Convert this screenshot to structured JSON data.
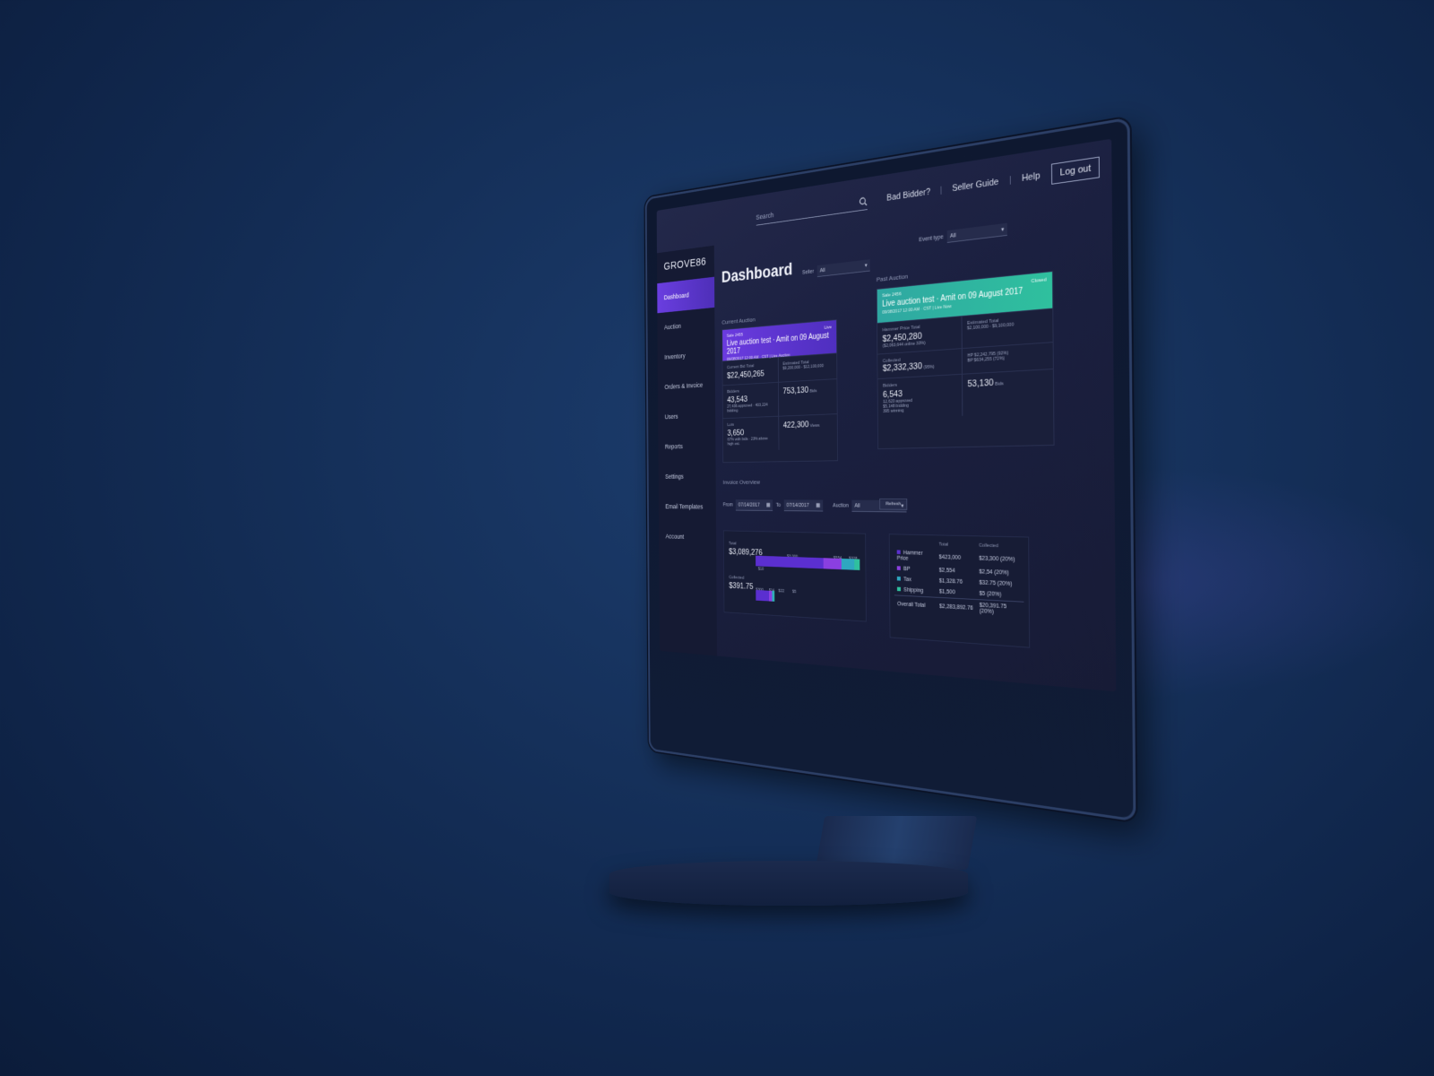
{
  "header": {
    "search_placeholder": "Search",
    "links": [
      "Bad Bidder?",
      "Seller Guide",
      "Help"
    ],
    "logout": "Log out"
  },
  "sidebar": {
    "logo": "GROVE86",
    "items": [
      {
        "label": "Dashboard",
        "active": true
      },
      {
        "label": "Auction"
      },
      {
        "label": "Inventory"
      },
      {
        "label": "Orders & Invoice"
      },
      {
        "label": "Users"
      },
      {
        "label": "Reports"
      },
      {
        "label": "Settings"
      },
      {
        "label": "Email Templates"
      },
      {
        "label": "Account"
      }
    ]
  },
  "page": {
    "title": "Dashboard",
    "seller_label": "Seller",
    "seller_value": "All",
    "event_type_label": "Event type",
    "event_type_value": "All"
  },
  "current_auction": {
    "section": "Current Auction",
    "sale": "Sale 2455",
    "title": "Live auction test · Amit on 09 August 2017",
    "meta": "09/08/2017 12:00 AM · CST  |  Live Auction",
    "badge": "Live",
    "current_bid_label": "Current Bid Total",
    "current_bid_value": "$22,450,265",
    "estimated_label": "Estimated Total",
    "estimated_value": "$9,200,000 - $12,100,000",
    "bidders_label": "Bidders",
    "bidders_value": "43,543",
    "bidders_note": "27,436 approved · 403,224 bidding",
    "bids_value": "753,130",
    "bids_unit": "Bids",
    "lots_label": "Lots",
    "lots_value": "3,650",
    "lots_note": "67% with bids · 23% above high est.",
    "views_value": "422,300",
    "views_unit": "Views"
  },
  "past_auction": {
    "section": "Past Auction",
    "sale": "Sale 2456",
    "title": "Live auction test · Amit on 09 August 2017",
    "meta": "09/08/2017 12:00 AM · CST  |  Live Now",
    "badge": "Closed",
    "hammer_label": "Hammer Price Total",
    "hammer_value": "$2,450,280",
    "hammer_note": "($2,063,644 online 33%)",
    "estimated_label": "Estimated Total",
    "estimated_value": "$2,100,000 - $9,100,000",
    "collected_label": "Collected",
    "collected_value": "$2,332,330",
    "collected_pct": "(95%)",
    "hp_note": "HP $2,242,795 (92%)",
    "bp_note": "BP $634,255 (72%)",
    "bidders_label": "Bidders",
    "bidders_value": "6,543",
    "bidders_note1": "12,620 approved",
    "bidders_note2": "$5,148 bidding",
    "bidders_note3": "395 winning",
    "bids_value": "53,130",
    "bids_unit": "Bids"
  },
  "invoice": {
    "section": "Invoice Overview",
    "from_label": "From",
    "from_value": "07/14/2017",
    "to_label": "To",
    "to_value": "07/14/2017",
    "auction_label": "Auction",
    "auction_value": "All",
    "refresh": "Refresh",
    "total_label": "Total",
    "total_value": "$3,089,276",
    "collected_label": "Collected",
    "collected_value": "$391.75",
    "total_bar_labels": [
      "$3,000",
      "$554",
      "$328",
      "$10"
    ],
    "collected_bar_labels": [
      "$300",
      "$14",
      "$22",
      "$5"
    ],
    "total_bar_fractions": [
      0.66,
      0.17,
      0.12,
      0.05
    ],
    "collected_bar_fractions": [
      0.7,
      0.15,
      0.1,
      0.05
    ],
    "table": {
      "headers": [
        "",
        "Total",
        "Collected"
      ],
      "rows": [
        {
          "label": "Hammer Price",
          "total": "$423,000",
          "collected": "$23,300 (20%)",
          "color": "#5b2fd0"
        },
        {
          "label": "BP",
          "total": "$2,554",
          "collected": "$2,54 (20%)",
          "color": "#8a3fe0"
        },
        {
          "label": "Tax",
          "total": "$1,328.76",
          "collected": "$32.75 (20%)",
          "color": "#2fa7c0"
        },
        {
          "label": "Shipping",
          "total": "$1,500",
          "collected": "$5 (20%)",
          "color": "#2fc09e"
        }
      ],
      "overall_label": "Overall Total",
      "overall_total": "$2,283,892.76",
      "overall_collected": "$20,391.75 (20%)"
    }
  },
  "colors": {
    "accent_purple": "#6b3be0",
    "accent_teal": "#2fc09e"
  }
}
